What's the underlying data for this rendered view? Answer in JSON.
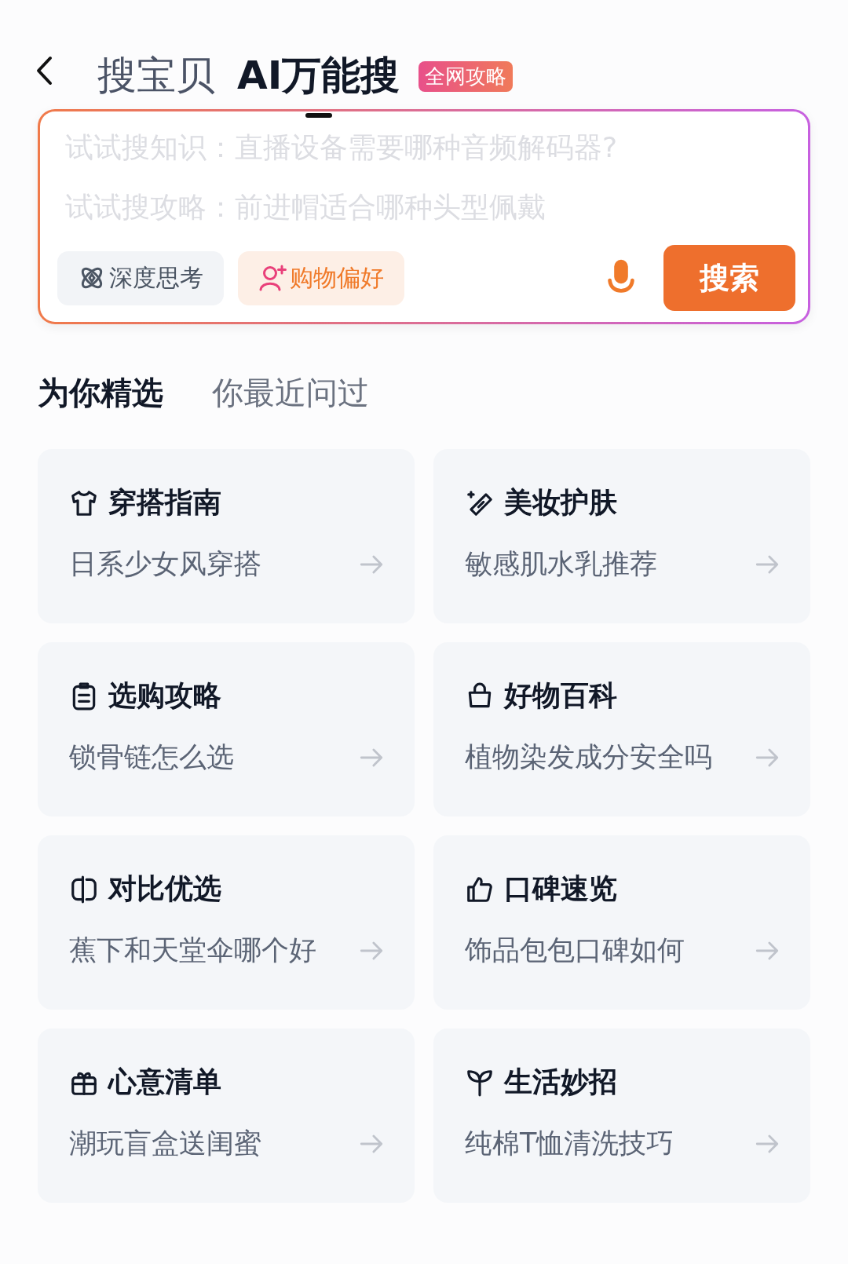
{
  "tabs": [
    {
      "label": "搜宝贝",
      "selected": false
    },
    {
      "label": "AI万能搜",
      "selected": true,
      "badge": "全网攻略"
    }
  ],
  "search": {
    "placeholder": [
      "试试搜知识：直播设备需要哪种音频解码器?",
      "试试搜攻略：前进帽适合哪种头型佩戴"
    ],
    "chips": [
      {
        "label": "深度思考",
        "selected": false
      },
      {
        "label": "购物偏好",
        "selected": true
      }
    ],
    "button": "搜索"
  },
  "section_tabs": [
    {
      "label": "为你精选",
      "selected": true
    },
    {
      "label": "你最近问过",
      "selected": false
    }
  ],
  "cards": [
    {
      "title": "穿搭指南",
      "query": "日系少女风穿搭"
    },
    {
      "title": "美妆护肤",
      "query": "敏感肌水乳推荐"
    },
    {
      "title": "选购攻略",
      "query": "锁骨链怎么选"
    },
    {
      "title": "好物百科",
      "query": "植物染发成分安全吗"
    },
    {
      "title": "对比优选",
      "query": "蕉下和天堂伞哪个好"
    },
    {
      "title": "口碑速览",
      "query": "饰品包包口碑如何"
    },
    {
      "title": "心意清单",
      "query": "潮玩盲盒送闺蜜"
    },
    {
      "title": "生活妙招",
      "query": "纯棉T恤清洗技巧"
    }
  ]
}
